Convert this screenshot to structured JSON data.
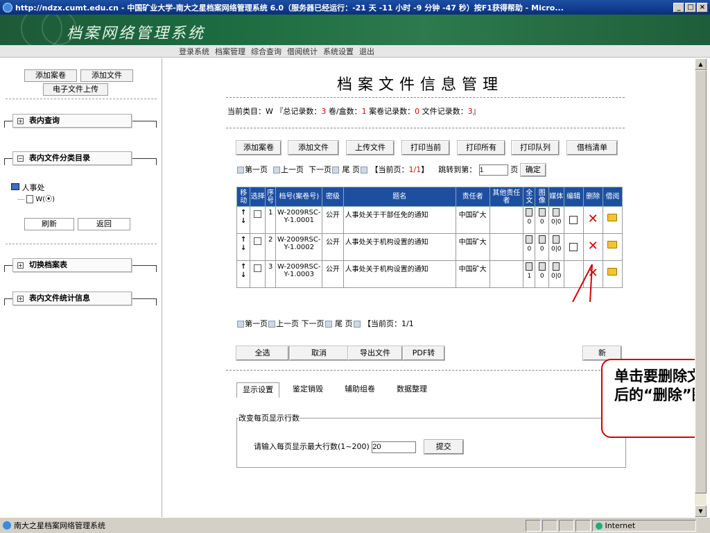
{
  "window": {
    "title": "http://ndzx.cumt.edu.cn - 中国矿业大学-南大之星档案网络管理系统 6.0（服务器已经运行：-21 天 -11 小时 -9 分钟 -47 秒）按F1获得帮助 - Micro..."
  },
  "banner": {
    "title": "档案网络管理系统"
  },
  "menu": [
    "登录系统",
    "档案管理",
    "综合查询",
    "借阅统计",
    "系统设置",
    "退出"
  ],
  "sidebar": {
    "btn_add_volume": "添加案卷",
    "btn_add_file": "添加文件",
    "btn_upload": "电子文件上传",
    "sec_query": "表内查询",
    "sec_catalog": "表内文件分类目录",
    "tree_root": "人事处",
    "tree_child": "W(⦿)",
    "btn_refresh": "刷新",
    "btn_back": "返回",
    "sec_switch": "切换档案表",
    "sec_stats": "表内文件统计信息"
  },
  "main": {
    "title": "档案文件信息管理",
    "category_text": "当前类目：W 『总记录数：",
    "total": "3",
    "mid1": " 卷/盒数：",
    "vols": "1",
    "mid2": " 案卷记录数：",
    "case_recs": "0",
    "mid3": " 文件记录数：",
    "file_recs": "3",
    "end": "』",
    "actions": [
      "添加案卷",
      "添加文件",
      "上传文件",
      "打印当前",
      "打印所有",
      "打印队列",
      "借档清单"
    ],
    "nav": {
      "first": "第一页",
      "prev": "上一页",
      "next": "下一页",
      "last": "尾 页",
      "current_label": "【当前页：",
      "current": "1/1",
      "current_end": "】",
      "jump": "跳转到第：",
      "jump_value": "1",
      "page": "页",
      "confirm": "确定"
    },
    "columns": [
      "移动",
      "选择",
      "序号",
      "档号(案卷号)",
      "密级",
      "题名",
      "责任者",
      "其他责任者",
      "全文",
      "图像",
      "媒体",
      "编辑",
      "删除",
      "借阅"
    ],
    "rows": [
      {
        "seq": "1",
        "code": "W-2009RSC-Y-1.0001",
        "secret": "公开",
        "title": "人事处关于干部任免的通知",
        "owner": "中国矿大",
        "full": "0",
        "img": "0",
        "media": "0|0"
      },
      {
        "seq": "2",
        "code": "W-2009RSC-Y-1.0002",
        "secret": "公开",
        "title": "人事处关于机构设置的通知",
        "owner": "中国矿大",
        "full": "0",
        "img": "0",
        "media": "0|0"
      },
      {
        "seq": "3",
        "code": "W-2009RSC-Y-1.0003",
        "secret": "公开",
        "title": "人事处关于机构设置的通知",
        "owner": "中国矿大",
        "full": "1",
        "img": "0",
        "media": "0|0"
      }
    ],
    "nav2": {
      "first": "第一页",
      "prev": "上一页",
      "next": "下一页",
      "last": "尾 页",
      "current": "【当前页：1/1"
    },
    "bottom_buttons": [
      "全选",
      "取消",
      "导出文件",
      "PDF转"
    ],
    "bottom_refresh_tail": "新",
    "tabs": [
      "显示设置",
      "鉴定销毁",
      "辅助组卷",
      "数据整理"
    ],
    "fieldset_legend": "改变每页显示行数",
    "rows_label": "请输入每页显示最大行数(1~200)",
    "rows_value": "20",
    "submit": "提交"
  },
  "callout": {
    "text": "单击要删除文件条目后的“删除”图标"
  },
  "status": {
    "text": "南大之星档案网络管理系统",
    "zone": "Internet"
  }
}
